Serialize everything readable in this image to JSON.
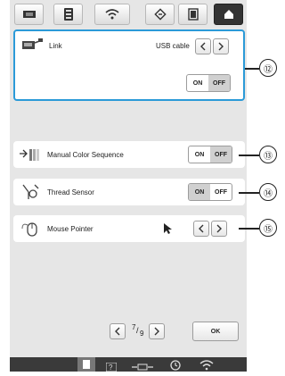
{
  "topbar": {
    "icons": [
      "embroidery-frame-icon",
      "machine-settings-icon",
      "wifi-icon",
      "diamond-icon",
      "frame-square-icon",
      "home-icon"
    ]
  },
  "link_panel": {
    "label": "Link",
    "value": "USB cable",
    "on_label": "ON",
    "off_label": "OFF",
    "selected": "OFF"
  },
  "manual_color_sequence": {
    "label": "Manual Color Sequence",
    "on_label": "ON",
    "off_label": "OFF",
    "selected": "OFF"
  },
  "thread_sensor": {
    "label": "Thread Sensor",
    "on_label": "ON",
    "off_label": "OFF",
    "selected": "ON"
  },
  "mouse_pointer": {
    "label": "Mouse Pointer"
  },
  "pagination": {
    "current": "7",
    "total": "9",
    "ok_label": "OK"
  },
  "callouts": [
    "⑫",
    "⑬",
    "⑭",
    "⑮"
  ],
  "colors": {
    "highlight": "#2b9ad8",
    "bar": "#3a3a3a"
  }
}
